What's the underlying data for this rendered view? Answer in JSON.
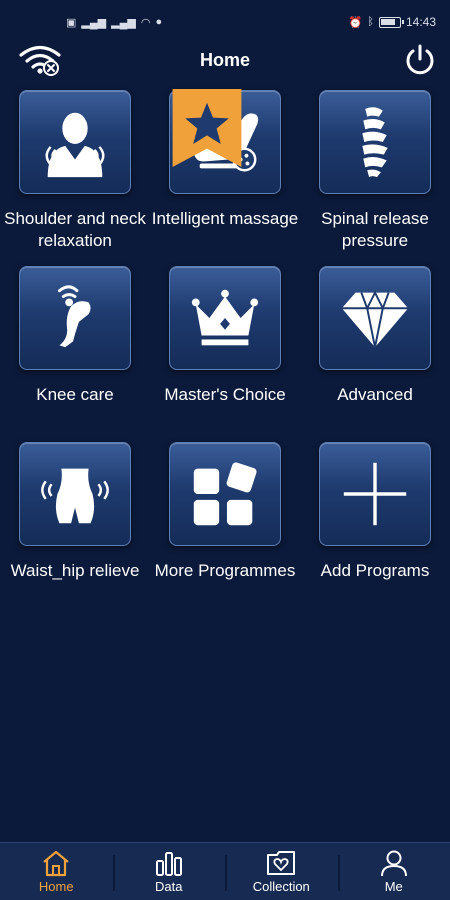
{
  "status_bar": {
    "time": "14:43",
    "left_icons": [
      "sim-icon",
      "signal-icon",
      "signal-icon",
      "wifi-icon",
      "wechat-icon"
    ],
    "right_icons": [
      "alarm-icon",
      "bluetooth-icon",
      "battery-icon"
    ]
  },
  "header": {
    "title": "Home"
  },
  "programs": [
    {
      "label": "Shoulder and neck relaxation",
      "icon": "shoulder-neck-icon"
    },
    {
      "label": "Intelligent massage",
      "icon": "massage-chair-icon",
      "badge": "star"
    },
    {
      "label": "Spinal release pressure",
      "icon": "spine-icon"
    },
    {
      "label": "Knee care",
      "icon": "knee-icon"
    },
    {
      "label": "Master's Choice",
      "icon": "crown-icon"
    },
    {
      "label": "Advanced",
      "icon": "diamond-icon"
    },
    {
      "label": "Waist_hip relieve",
      "icon": "waist-hip-icon"
    },
    {
      "label": "More Programmes",
      "icon": "grid-blocks-icon"
    },
    {
      "label": "Add Programs",
      "icon": "plus-icon"
    }
  ],
  "bottom_nav": [
    {
      "label": "Home",
      "icon": "home-icon",
      "active": true
    },
    {
      "label": "Data",
      "icon": "bar-chart-icon",
      "active": false
    },
    {
      "label": "Collection",
      "icon": "heart-folder-icon",
      "active": false
    },
    {
      "label": "Me",
      "icon": "person-icon",
      "active": false
    }
  ],
  "colors": {
    "background": "#0b1a3a",
    "tile_top": "#3a5d99",
    "tile_bottom": "#142c58",
    "accent": "#f1a13a",
    "nav_bg": "#172a52"
  }
}
